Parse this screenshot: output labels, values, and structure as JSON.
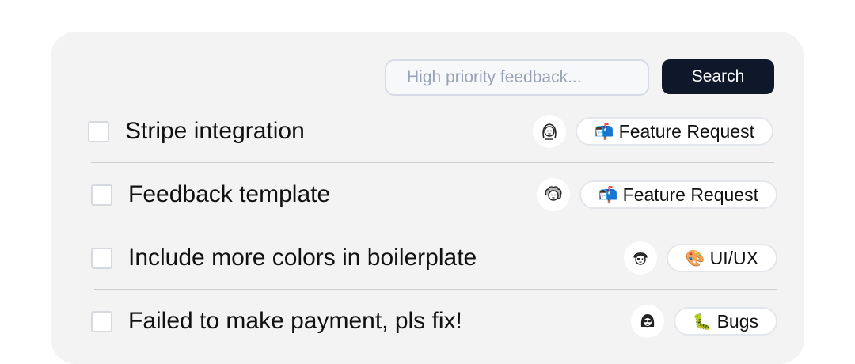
{
  "search": {
    "placeholder": "High priority feedback...",
    "button_label": "Search"
  },
  "items": [
    {
      "title": "Stripe integration",
      "tag_emoji": "📬",
      "tag_label": "Feature Request",
      "avatar_icon": "sketch-avatar-long-hair-icon",
      "checked": false
    },
    {
      "title": "Feedback template",
      "tag_emoji": "📬",
      "tag_label": "Feature Request",
      "avatar_icon": "sketch-avatar-curly-hair-icon",
      "checked": false
    },
    {
      "title": "Include more colors in boilerplate",
      "tag_emoji": "🎨",
      "tag_label": "UI/UX",
      "avatar_icon": "sketch-avatar-beanie-icon",
      "checked": false
    },
    {
      "title": "Failed to make payment, pls fix!",
      "tag_emoji": "🐛",
      "tag_label": "Bugs",
      "avatar_icon": "sketch-avatar-sunglasses-icon",
      "checked": false
    }
  ],
  "colors": {
    "card_background": "#f3f3f3",
    "button_background": "#0f172a",
    "divider": "#cfcfcf"
  }
}
